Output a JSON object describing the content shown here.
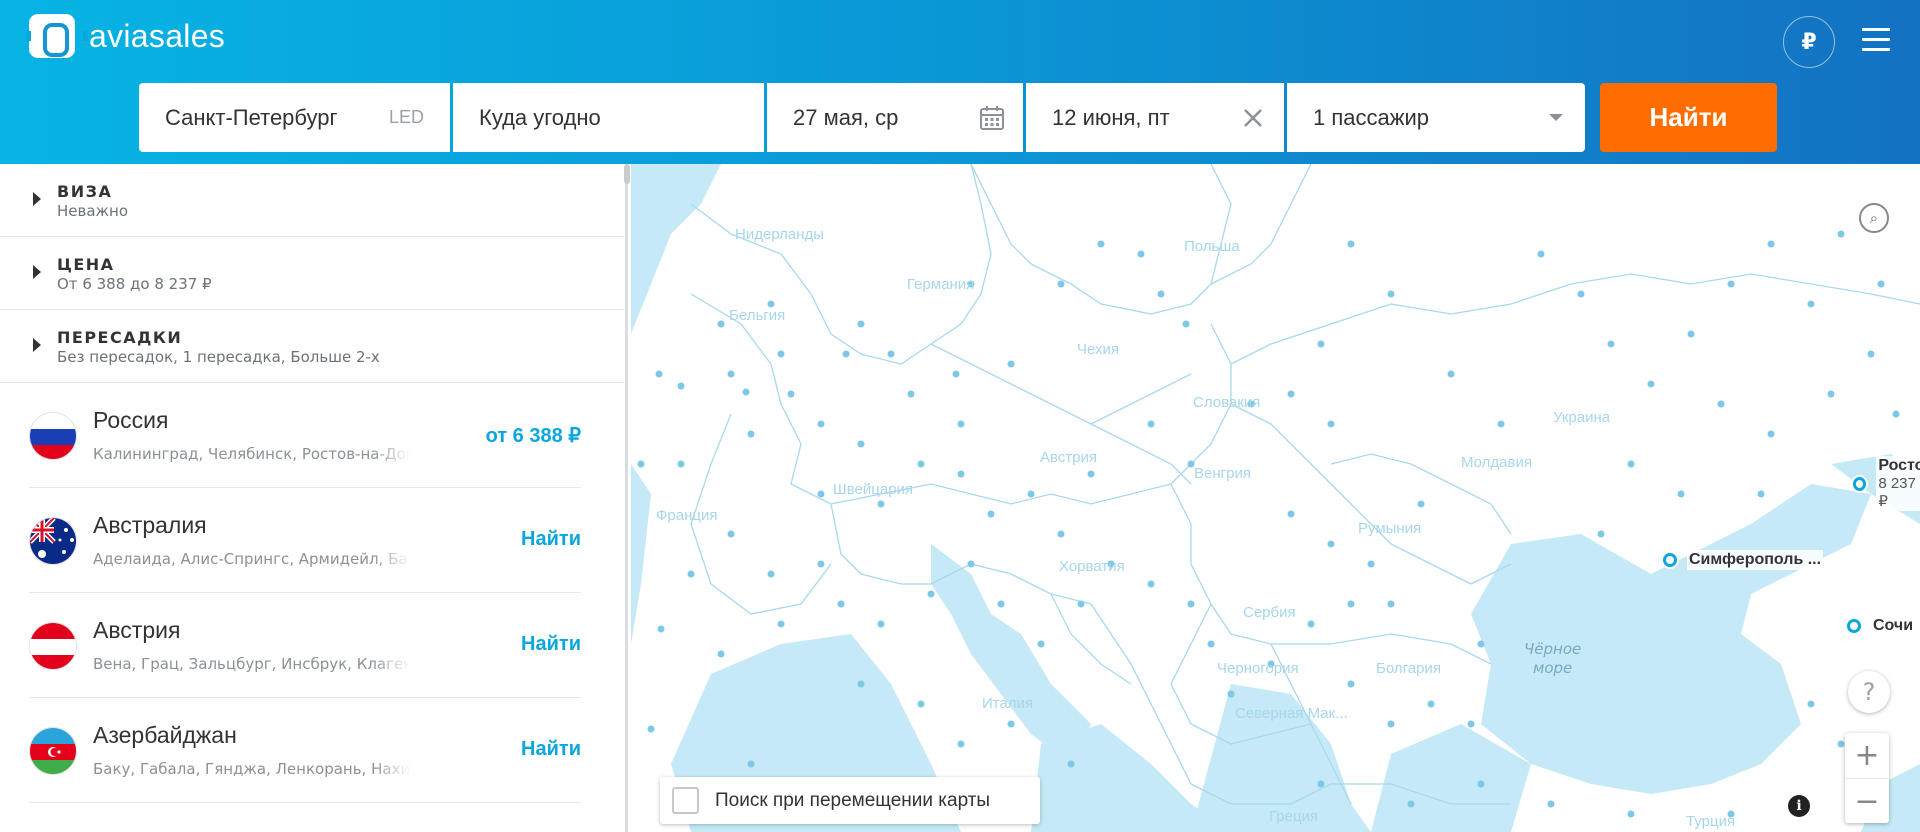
{
  "header": {
    "logo_text": "aviasales",
    "currency_symbol": "₽"
  },
  "search": {
    "origin_value": "Санкт-Петербург",
    "origin_iata": "LED",
    "destination_value": "Куда угодно",
    "depart_value": "27 мая, ср",
    "return_value": "12 июня, пт",
    "passengers_value": "1 пассажир",
    "find_label": "Найти"
  },
  "filters": [
    {
      "title": "ВИЗА",
      "subtitle": "Неважно"
    },
    {
      "title": "ЦЕНА",
      "subtitle": "От 6 388 до 8 237 ₽"
    },
    {
      "title": "ПЕРЕСАДКИ",
      "subtitle": "Без пересадок, 1 пересадка, Больше 2-х"
    }
  ],
  "countries": [
    {
      "name": "Россия",
      "cities": "Калининград, Челябинск, Ростов-на-Дону, Сочи",
      "action": "от 6 388 ₽"
    },
    {
      "name": "Австралия",
      "cities": "Аделаида, Алис-Спрингс, Армидейл, Балларат",
      "action": "Найти"
    },
    {
      "name": "Австрия",
      "cities": "Вена, Грац, Зальцбург, Инсбрук, Клагенфурт",
      "action": "Найти"
    },
    {
      "name": "Азербайджан",
      "cities": "Баку, Габала, Гянджа, Ленкорань, Нахичевань",
      "action": "Найти"
    }
  ],
  "map": {
    "country_labels": [
      "Нидерланды",
      "Германия",
      "Польша",
      "Бельгия",
      "Чехия",
      "Словакия",
      "Украина",
      "Австрия",
      "Швейцария",
      "Венгрия",
      "Молдавия",
      "Франция",
      "Румыния",
      "Хорватия",
      "Сербия",
      "Италия",
      "Черногория",
      "Болгария",
      "Северная Мак...",
      "Греция",
      "Турция"
    ],
    "sea_label": "Чёрное\nморе",
    "markers": [
      {
        "label": "Росто",
        "price": "8 237 ₽"
      },
      {
        "label": "Симферополь ...",
        "price": ""
      },
      {
        "label": "Сочи",
        "price": ""
      }
    ],
    "search_on_move_label": "Поиск при перемещении карты",
    "help_symbol": "?",
    "zoom_in": "+",
    "zoom_out": "−",
    "info_symbol": "i"
  },
  "colors": {
    "brand_gradient_start": "#07b4e4",
    "brand_gradient_end": "#1372c2",
    "find_button": "#ff6d00",
    "price_accent": "#0aa6de",
    "water": "#c5e9f7",
    "borders": "#a9d8ee"
  }
}
